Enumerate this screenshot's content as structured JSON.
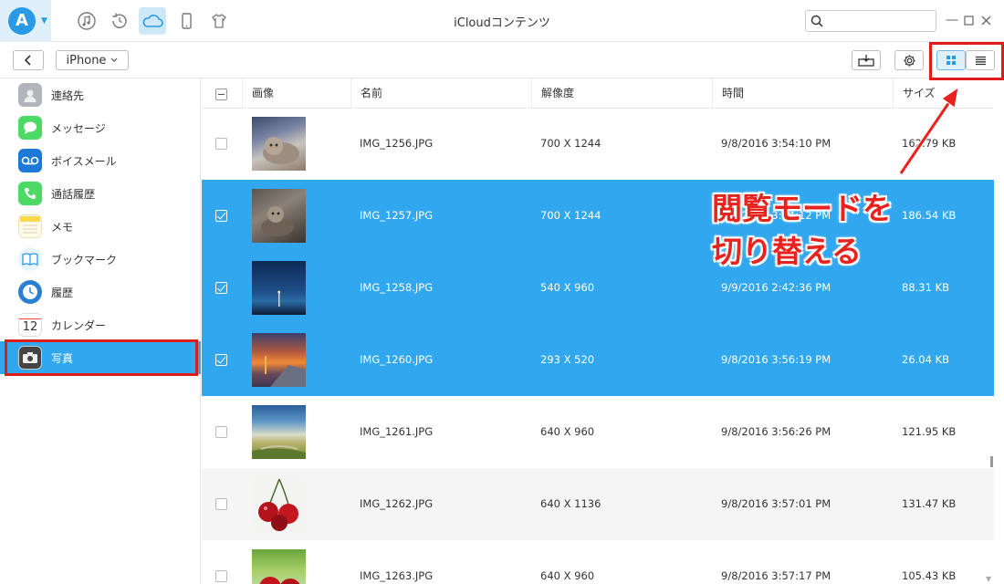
{
  "window": {
    "title": "iCloudコンテンツ"
  },
  "topnav": {
    "icons": [
      "music-icon",
      "history-restore-icon",
      "icloud-icon",
      "iphone-icon",
      "tshirt-icon"
    ],
    "active": "icloud-icon"
  },
  "search": {
    "value": "",
    "placeholder": ""
  },
  "toolbar": {
    "device_label": "iPhone"
  },
  "sidebar": {
    "items": [
      {
        "label": "連絡先",
        "icon": "contacts-icon",
        "color": "#9ea3aa"
      },
      {
        "label": "メッセージ",
        "icon": "messages-icon",
        "color": "#4cd964"
      },
      {
        "label": "ボイスメール",
        "icon": "voicemail-icon",
        "color": "#1e78d6"
      },
      {
        "label": "通話履歴",
        "icon": "phone-icon",
        "color": "#4cd964"
      },
      {
        "label": "メモ",
        "icon": "notes-icon",
        "color": "#ffd84a"
      },
      {
        "label": "ブックマーク",
        "icon": "bookmark-icon",
        "color": "#2a9ae6"
      },
      {
        "label": "履歴",
        "icon": "clock-icon",
        "color": "#2a7fd0"
      },
      {
        "label": "カレンダー",
        "icon": "calendar-icon",
        "calendar_day": "12"
      },
      {
        "label": "写真",
        "icon": "camera-icon",
        "color": "#555555",
        "active": true
      }
    ]
  },
  "table": {
    "columns": [
      "画像",
      "名前",
      "解像度",
      "時間",
      "サイズ"
    ],
    "rows": [
      {
        "name": "IMG_1256.JPG",
        "resolution": "700 X 1244",
        "time": "9/8/2016 3:54:10 PM",
        "size": "162.79 KB",
        "selected": false,
        "thumb": "cat"
      },
      {
        "name": "IMG_1257.JPG",
        "resolution": "700 X 1244",
        "time": "9/8/2016 3:54:12 PM",
        "size": "186.54 KB",
        "selected": true,
        "thumb": "cat2"
      },
      {
        "name": "IMG_1258.JPG",
        "resolution": "540 X 960",
        "time": "9/9/2016 2:42:36 PM",
        "size": "88.31 KB",
        "selected": true,
        "thumb": "night"
      },
      {
        "name": "IMG_1260.JPG",
        "resolution": "293 X 520",
        "time": "9/8/2016 3:56:19 PM",
        "size": "26.04 KB",
        "selected": true,
        "thumb": "sunset"
      },
      {
        "name": "IMG_1261.JPG",
        "resolution": "640 X 960",
        "time": "9/8/2016 3:56:26 PM",
        "size": "121.95 KB",
        "selected": false,
        "thumb": "sky"
      },
      {
        "name": "IMG_1262.JPG",
        "resolution": "640 X 1136",
        "time": "9/8/2016 3:57:01 PM",
        "size": "131.47 KB",
        "selected": false,
        "thumb": "cherry"
      },
      {
        "name": "IMG_1263.JPG",
        "resolution": "640 X 960",
        "time": "9/8/2016 3:57:17 PM",
        "size": "105.43 KB",
        "selected": false,
        "thumb": "cherry2"
      }
    ]
  },
  "annotation": {
    "line1": "閲覧モードを",
    "line2": "切り替える"
  },
  "colors": {
    "accent": "#30a7ee",
    "highlight": "#e01b1b"
  }
}
